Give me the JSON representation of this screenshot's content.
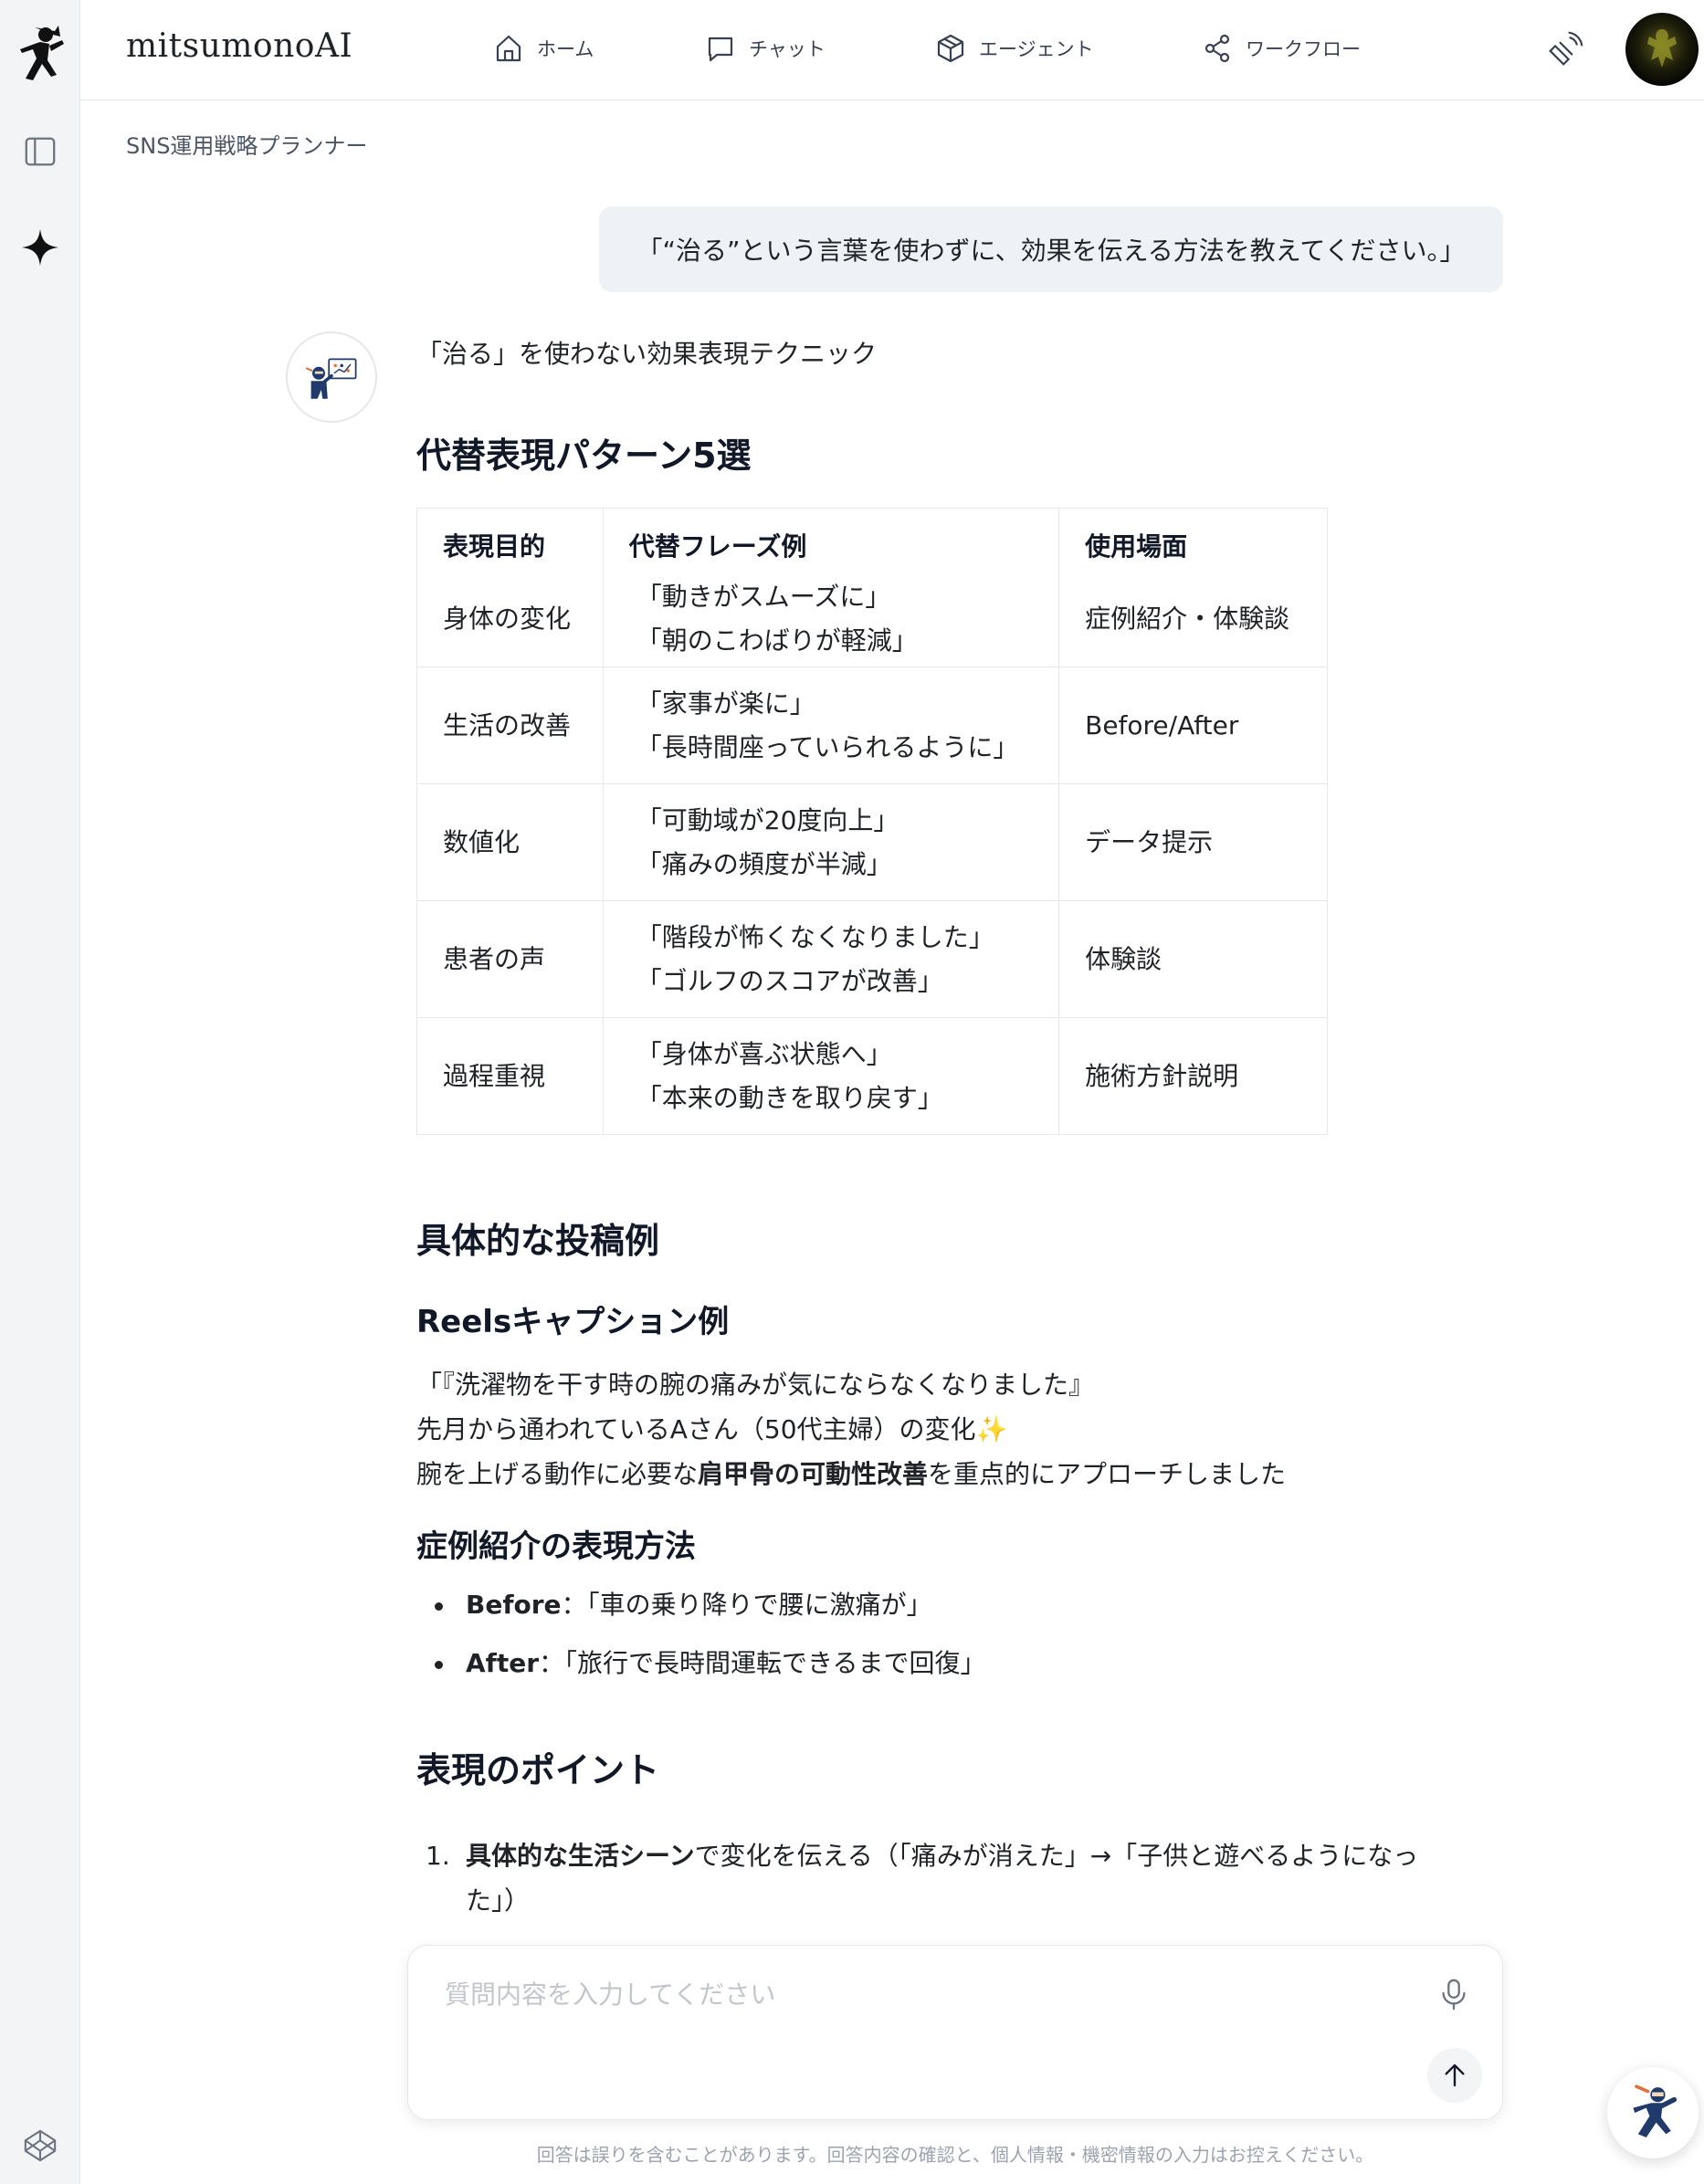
{
  "app": {
    "brand": "mitsumonoAI"
  },
  "nav": [
    {
      "label": "ホーム",
      "icon": "home-icon"
    },
    {
      "label": "チャット",
      "icon": "chat-icon"
    },
    {
      "label": "エージェント",
      "icon": "cube-icon"
    },
    {
      "label": "ワークフロー",
      "icon": "share-icon"
    }
  ],
  "breadcrumb": "SNS運用戦略プランナー",
  "user_message": "「“治る”という言葉を使わずに、効果を伝える方法を教えてください。」",
  "answer": {
    "lead": "「治る」を使わない効果表現テクニック",
    "h_alt": "代替表現パターン5選",
    "table": {
      "headers": [
        "表現目的",
        "代替フレーズ例",
        "使用場面"
      ],
      "rows": [
        {
          "purpose": "身体の変化",
          "p1": "「動きがスムーズに」",
          "p2": "「朝のこわばりが軽減」",
          "scene": "症例紹介・体験談"
        },
        {
          "purpose": "生活の改善",
          "p1": "「家事が楽に」",
          "p2": "「長時間座っていられるように」",
          "scene": "Before/After"
        },
        {
          "purpose": "数値化",
          "p1": "「可動域が20度向上」",
          "p2": "「痛みの頻度が半減」",
          "scene": "データ提示"
        },
        {
          "purpose": "患者の声",
          "p1": "「階段が怖くなくなりました」",
          "p2": "「ゴルフのスコアが改善」",
          "scene": "体験談"
        },
        {
          "purpose": "過程重視",
          "p1": "「身体が喜ぶ状態へ」",
          "p2": "「本来の動きを取り戻す」",
          "scene": "施術方針説明"
        }
      ]
    },
    "h_post": "具体的な投稿例",
    "h_reels": "Reelsキャプション例",
    "reels_line1": "「『洗濯物を干す時の腕の痛みが気にならなくなりました』",
    "reels_line2": "先月から通われているAさん（50代主婦）の変化✨",
    "reels_line3_pre": "腕を上げる動作に必要な",
    "reels_line3_bold": "肩甲骨の可動性改善",
    "reels_line3_post": "を重点的にアプローチしました",
    "h_case": "症例紹介の表現方法",
    "before_label": "Before",
    "before_text": "：「車の乗り降りで腰に激痛が」",
    "after_label": "After",
    "after_text": "：「旅行で長時間運転できるまで回復」",
    "h_point": "表現のポイント",
    "point1_num": "1.",
    "point1_bold": "具体的な生活シーン",
    "point1_text": "で変化を伝える（「痛みが消えた」→「子供と遊べるようになった」）"
  },
  "composer": {
    "placeholder": "質問内容を入力してください"
  },
  "disclaimer": "回答は誤りを含むことがあります。回答内容の確認と、個人情報・機密情報の入力はお控えください。"
}
